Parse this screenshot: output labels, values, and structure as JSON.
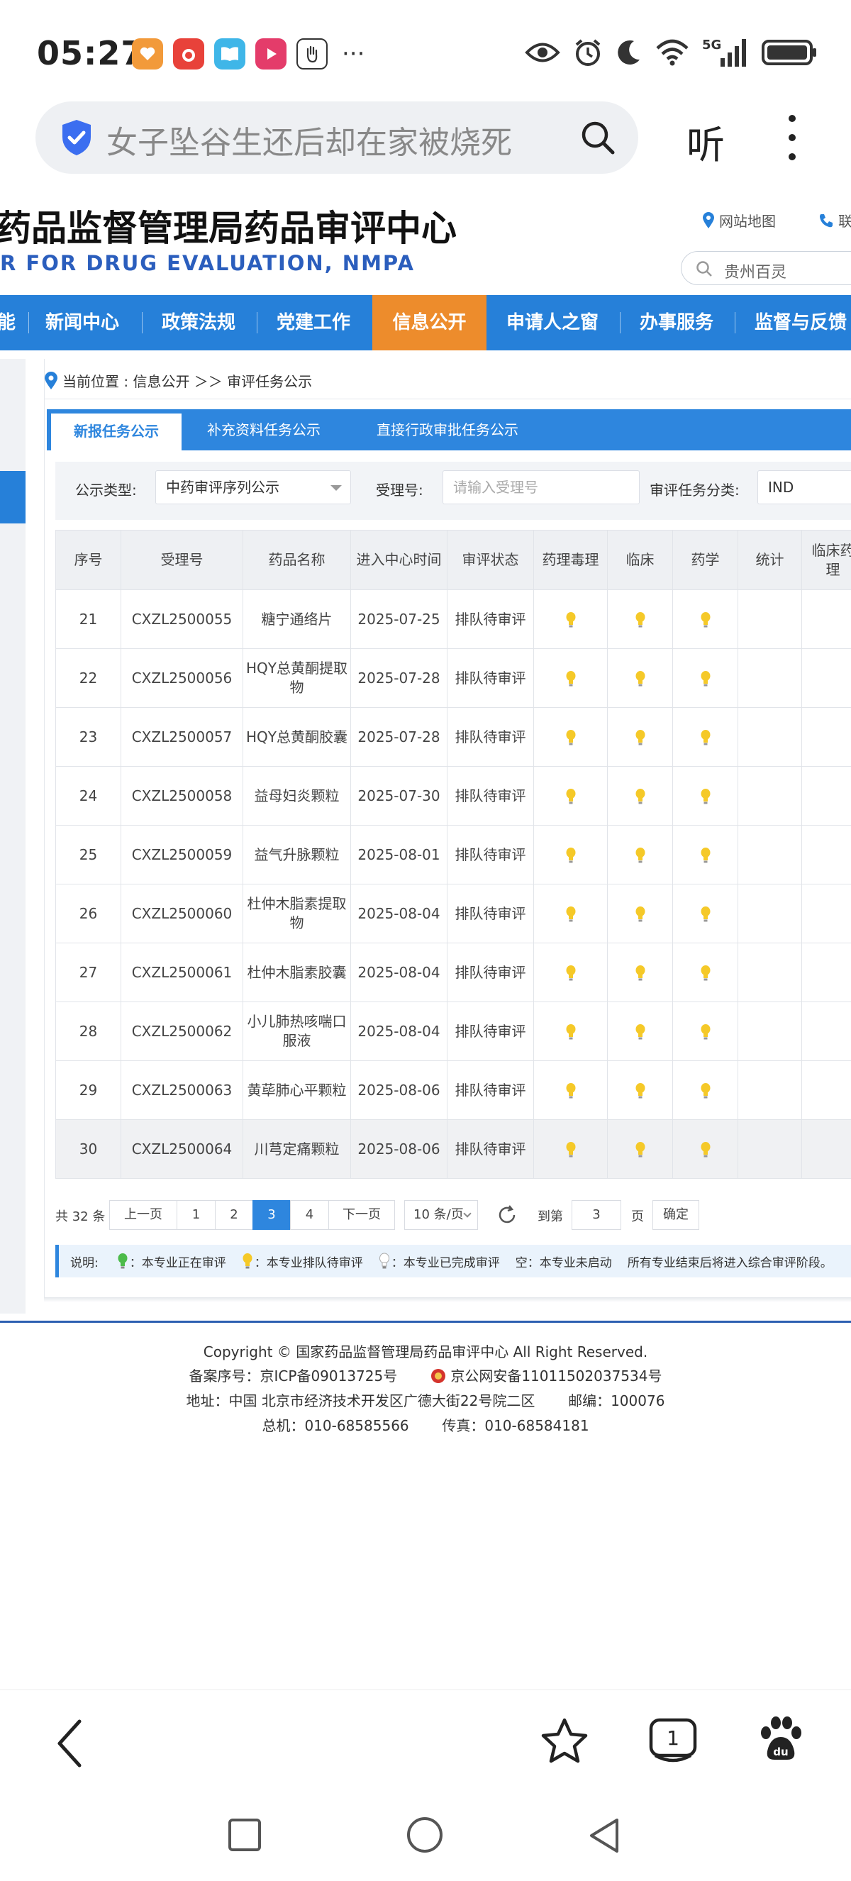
{
  "status_bar": {
    "time": "05:27",
    "app_icons": [
      "heart-app-icon",
      "red-app-icon",
      "book-app-icon",
      "video-app-icon",
      "hand-app-icon"
    ],
    "overflow": "···",
    "indicators": [
      "eye-icon",
      "alarm-icon",
      "moon-icon",
      "wifi-icon",
      "5g-signal-icon",
      "battery-icon"
    ],
    "network": "5G"
  },
  "browser": {
    "search_query": "女子坠谷生还后却在家被烧死",
    "listen_label": "听"
  },
  "site": {
    "title": "药品监督管理局药品审评中心",
    "subtitle": "R FOR DRUG EVALUATION, NMPA",
    "sitemap_link": "网站地图",
    "contact_link": "联",
    "search_placeholder": "贵州百灵"
  },
  "nav": {
    "items": [
      "能",
      "新闻中心",
      "政策法规",
      "党建工作",
      "信息公开",
      "申请人之窗",
      "办事服务",
      "监督与反馈"
    ],
    "active_index": 4
  },
  "breadcrumb": {
    "text": "当前位置 : 信息公开 ＞＞ 审评任务公示"
  },
  "tabs": {
    "items": [
      "新报任务公示",
      "补充资料任务公示",
      "直接行政审批任务公示"
    ],
    "active_index": 0
  },
  "filters": {
    "type_label": "公示类型:",
    "type_value": "中药审评序列公示",
    "acceptance_label": "受理号:",
    "acceptance_placeholder": "请输入受理号",
    "category_label": "审评任务分类:",
    "category_value": "IND"
  },
  "table": {
    "headers": [
      "序号",
      "受理号",
      "药品名称",
      "进入中心时间",
      "审评状态",
      "药理毒理",
      "临床",
      "药学",
      "统计",
      "临床药理"
    ],
    "rows": [
      {
        "no": "21",
        "id": "CXZL2500055",
        "name": "糖宁通络片",
        "date": "2025-07-25",
        "status": "排队待审评"
      },
      {
        "no": "22",
        "id": "CXZL2500056",
        "name": "HQY总黄酮提取物",
        "date": "2025-07-28",
        "status": "排队待审评"
      },
      {
        "no": "23",
        "id": "CXZL2500057",
        "name": "HQY总黄酮胶囊",
        "date": "2025-07-28",
        "status": "排队待审评"
      },
      {
        "no": "24",
        "id": "CXZL2500058",
        "name": "益母妇炎颗粒",
        "date": "2025-07-30",
        "status": "排队待审评"
      },
      {
        "no": "25",
        "id": "CXZL2500059",
        "name": "益气升脉颗粒",
        "date": "2025-08-01",
        "status": "排队待审评"
      },
      {
        "no": "26",
        "id": "CXZL2500060",
        "name": "杜仲木脂素提取物",
        "date": "2025-08-04",
        "status": "排队待审评"
      },
      {
        "no": "27",
        "id": "CXZL2500061",
        "name": "杜仲木脂素胶囊",
        "date": "2025-08-04",
        "status": "排队待审评"
      },
      {
        "no": "28",
        "id": "CXZL2500062",
        "name": "小儿肺热咳喘口服液",
        "date": "2025-08-04",
        "status": "排队待审评"
      },
      {
        "no": "29",
        "id": "CXZL2500063",
        "name": "黄荜肺心平颗粒",
        "date": "2025-08-06",
        "status": "排队待审评"
      },
      {
        "no": "30",
        "id": "CXZL2500064",
        "name": "川芎定痛颗粒",
        "date": "2025-08-06",
        "status": "排队待审评"
      }
    ]
  },
  "pagination": {
    "total": "共 32 条",
    "prev": "上一页",
    "pages": [
      "1",
      "2",
      "3",
      "4"
    ],
    "current": "3",
    "next": "下一页",
    "page_size": "10 条/页",
    "goto_label": "到第",
    "goto_value": "3",
    "page_suffix": "页",
    "confirm": "确定"
  },
  "legend": {
    "title": "说明:",
    "in_review": "：本专业正在审评",
    "queued": "：本专业排队待审评",
    "completed": "：本专业已完成审评",
    "empty": "空：本专业未启动",
    "note": "所有专业结束后将进入综合审评阶段。"
  },
  "footer": {
    "copyright": "Copyright © 国家药品监督管理局药品审评中心   All Right Reserved.",
    "icp": "备案序号：京ICP备09013725号",
    "police": "京公网安备11011502037534号",
    "address": "地址：中国 北京市经济技术开发区广德大街22号院二区",
    "postcode": "邮编：100076",
    "phone": "总机：010-68585566",
    "fax": "传真：010-68584181"
  },
  "bottom_nav": {
    "tab_count": "1"
  },
  "colors": {
    "nav_blue": "#2680d9",
    "nav_active_orange": "#ed8c2c",
    "tab_blue": "#2e86de",
    "bulb_yellow": "#f5c928",
    "bulb_green": "#4cbb4a"
  }
}
